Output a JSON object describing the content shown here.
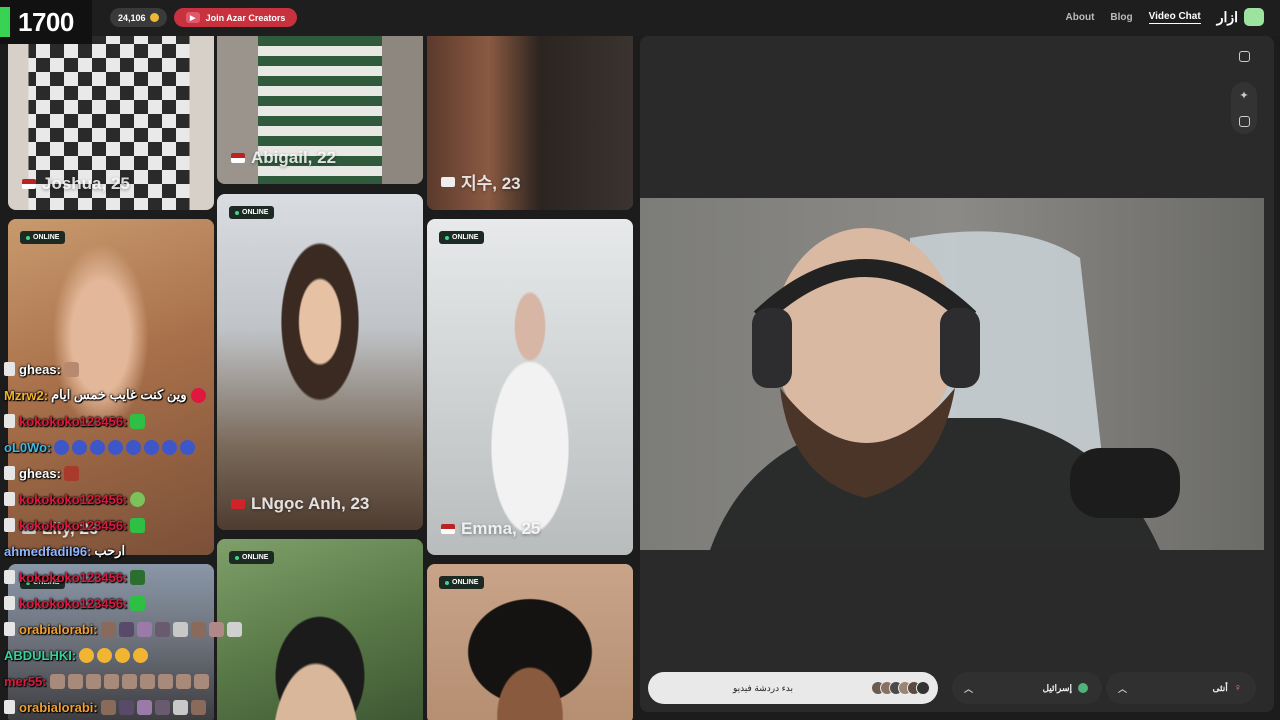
{
  "stream": {
    "viewer_count": "1700"
  },
  "header": {
    "coins": "24,106",
    "creators_button": "Join Azar Creators",
    "nav": {
      "about": "About",
      "blog": "Blog",
      "video_chat": "Video Chat"
    },
    "brand": "ازار"
  },
  "grid": {
    "online_label": "ONLINE",
    "cards": [
      {
        "name": "Joshua, 25"
      },
      {
        "name": "Abigail, 22"
      },
      {
        "name": "지수, 23"
      },
      {
        "name": "Lily, 26"
      },
      {
        "name": "LNgọc Anh, 23"
      },
      {
        "name": "Emma, 25"
      }
    ]
  },
  "video": {
    "start_button": "بدء دردشة فيديو",
    "region_selector": "إسرائيل",
    "gender_selector": "أنثى"
  },
  "chat": [
    {
      "user": "gheas:",
      "msg": "",
      "color": "#ffffff"
    },
    {
      "user": "Mzrw2:",
      "msg": "وين كنت غايب خمس ايام",
      "color": "#f0b429"
    },
    {
      "user": "kokokoko123456:",
      "msg": "",
      "color": "#e0173f"
    },
    {
      "user": "oL0Wo:",
      "msg": "",
      "color": "#3cb8e6"
    },
    {
      "user": "gheas:",
      "msg": "",
      "color": "#ffffff"
    },
    {
      "user": "kokokoko123456:",
      "msg": "",
      "color": "#e0173f"
    },
    {
      "user": "kokokoko123456:",
      "msg": "",
      "color": "#e0173f"
    },
    {
      "user": "ahmedfadil96:",
      "msg": "ارحب",
      "color": "#8fb6ff"
    },
    {
      "user": "kokokoko123456:",
      "msg": "",
      "color": "#e0173f"
    },
    {
      "user": "kokokoko123456:",
      "msg": "",
      "color": "#e0173f"
    },
    {
      "user": "orabialorabi:",
      "msg": "",
      "color": "#f0a030"
    },
    {
      "user": "ABDULHKI:",
      "msg": "",
      "color": "#34d39a"
    },
    {
      "user": "mer55:",
      "msg": "",
      "color": "#e0173f"
    },
    {
      "user": "orabialorabi:",
      "msg": "",
      "color": "#f0a030"
    }
  ],
  "colors": {
    "accent_green": "#39d353",
    "creators_red": "#c8323f",
    "online_green": "#3cd68a"
  }
}
